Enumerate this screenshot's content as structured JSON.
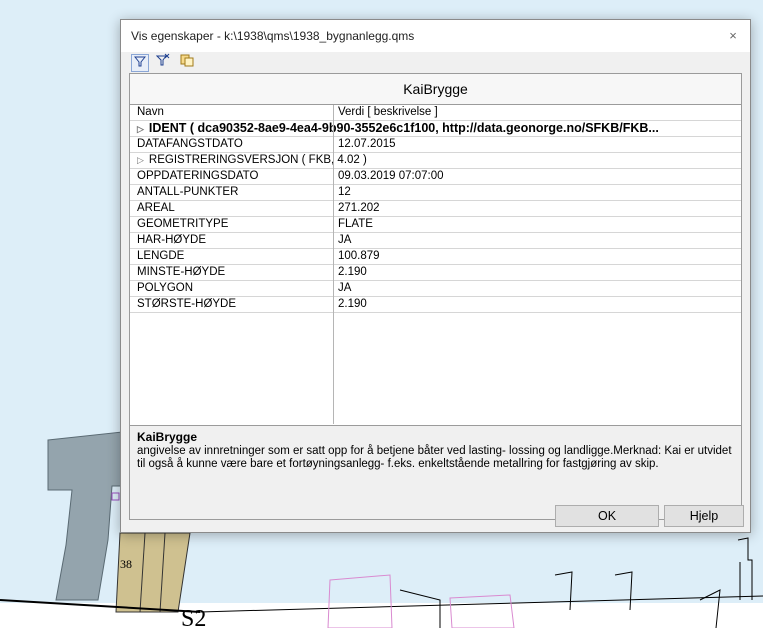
{
  "window": {
    "title": "Vis egenskaper - k:\\1938\\qms\\1938_bygnanlegg.qms",
    "close_glyph": "×"
  },
  "toolbar": {
    "icons": [
      "filter-icon",
      "filter-clear-icon",
      "copy-icon"
    ]
  },
  "panel": {
    "object_title": "KaiBrygge",
    "columns": {
      "name": "Navn",
      "value": "Verdi [ beskrivelse ]"
    },
    "ident_row": "IDENT ( dca90352-8ae9-4ea4-9b90-3552e6c1f100, http://data.geonorge.no/SFKB/FKB...",
    "rows": [
      {
        "name": "DATAFANGSTDATO",
        "value": "12.07.2015"
      }
    ],
    "version_row": "REGISTRERINGSVERSJON ( FKB, 4.02 )",
    "rows2": [
      {
        "name": "OPPDATERINGSDATO",
        "value": "09.03.2019 07:07:00"
      },
      {
        "name": "ANTALL-PUNKTER",
        "value": "12"
      },
      {
        "name": "AREAL",
        "value": "271.202"
      },
      {
        "name": "GEOMETRITYPE",
        "value": "FLATE"
      },
      {
        "name": "HAR-HØYDE",
        "value": "JA"
      },
      {
        "name": "LENGDE",
        "value": "100.879"
      },
      {
        "name": "MINSTE-HØYDE",
        "value": "2.190"
      },
      {
        "name": "POLYGON",
        "value": "JA"
      },
      {
        "name": "STØRSTE-HØYDE",
        "value": "2.190"
      }
    ],
    "description": {
      "title": "KaiBrygge",
      "text": "angivelse av innretninger som er satt opp for å betjene båter ved lasting- lossing og landligge.Merknad: Kai er utvidet til også å kunne være bare et fortøyningsanlegg- f.eks. enkeltstående metallring for fastgjøring av skip."
    }
  },
  "buttons": {
    "ok": "OK",
    "help": "Hjelp"
  },
  "map": {
    "labels": {
      "number": "38",
      "sheet": "S2"
    },
    "colors": {
      "background": "#ddeef8",
      "grey_building": "#94a4ad",
      "pier": "#cfc190",
      "pink_outline": "#d98ad0"
    }
  }
}
